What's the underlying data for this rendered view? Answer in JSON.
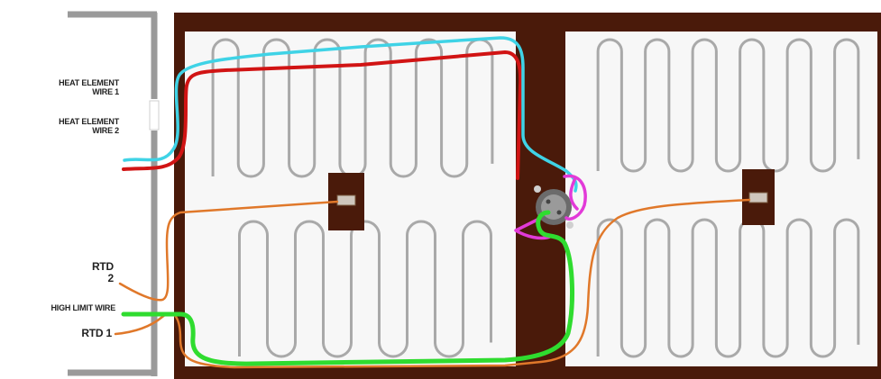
{
  "labels": {
    "heat_element_wire_1": [
      "HEAT ELEMENT",
      "WIRE 1"
    ],
    "heat_element_wire_2": [
      "HEAT ELEMENT",
      "WIRE 2"
    ],
    "rtd_2": [
      "RTD",
      "2"
    ],
    "high_limit_wire": "HIGH LIMIT WIRE",
    "rtd_1": "RTD 1"
  },
  "colors": {
    "board": "#4a1a0a",
    "frame": "#9a9a9a",
    "panel": "#f7f7f7",
    "element_coil": "#a9a9a9",
    "heat_wire_1": "#3fd3e6",
    "heat_wire_2": "#d11414",
    "rtd_wire": "#e0782a",
    "high_limit_wire": "#2fdc2f",
    "jumper_wire": "#e23ad8"
  }
}
